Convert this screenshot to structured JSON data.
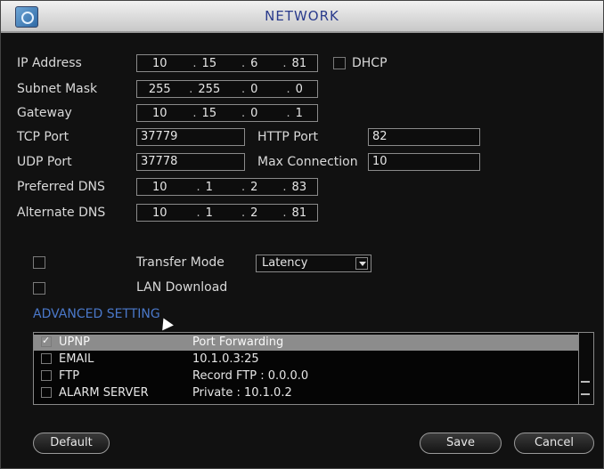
{
  "window": {
    "title": "NETWORK"
  },
  "fields": {
    "ip_address": {
      "label": "IP Address",
      "octets": [
        "10",
        "15",
        "6",
        "81"
      ]
    },
    "subnet_mask": {
      "label": "Subnet Mask",
      "octets": [
        "255",
        "255",
        "0",
        "0"
      ]
    },
    "gateway": {
      "label": "Gateway",
      "octets": [
        "10",
        "15",
        "0",
        "1"
      ]
    },
    "tcp_port": {
      "label": "TCP Port",
      "value": "37779"
    },
    "http_port": {
      "label": "HTTP Port",
      "value": "82"
    },
    "udp_port": {
      "label": "UDP Port",
      "value": "37778"
    },
    "max_connection": {
      "label": "Max Connection",
      "value": "10"
    },
    "preferred_dns": {
      "label": "Preferred DNS",
      "octets": [
        "10",
        "1",
        "2",
        "83"
      ]
    },
    "alternate_dns": {
      "label": "Alternate DNS",
      "octets": [
        "10",
        "1",
        "2",
        "81"
      ]
    },
    "dhcp": {
      "label": "DHCP"
    },
    "transfer_mode": {
      "label": "Transfer Mode",
      "selected": "Latency"
    },
    "lan_download": {
      "label": "LAN Download"
    }
  },
  "advanced": {
    "title": "ADVANCED SETTING",
    "rows": [
      {
        "name": "UPNP",
        "value": "Port Forwarding",
        "checked": true
      },
      {
        "name": "EMAIL",
        "value": "10.1.0.3:25",
        "checked": false
      },
      {
        "name": "FTP",
        "value": "Record FTP : 0.0.0.0",
        "checked": false
      },
      {
        "name": "ALARM SERVER",
        "value": "Private : 10.1.0.2",
        "checked": false
      }
    ]
  },
  "buttons": {
    "default": "Default",
    "save": "Save",
    "cancel": "Cancel"
  }
}
